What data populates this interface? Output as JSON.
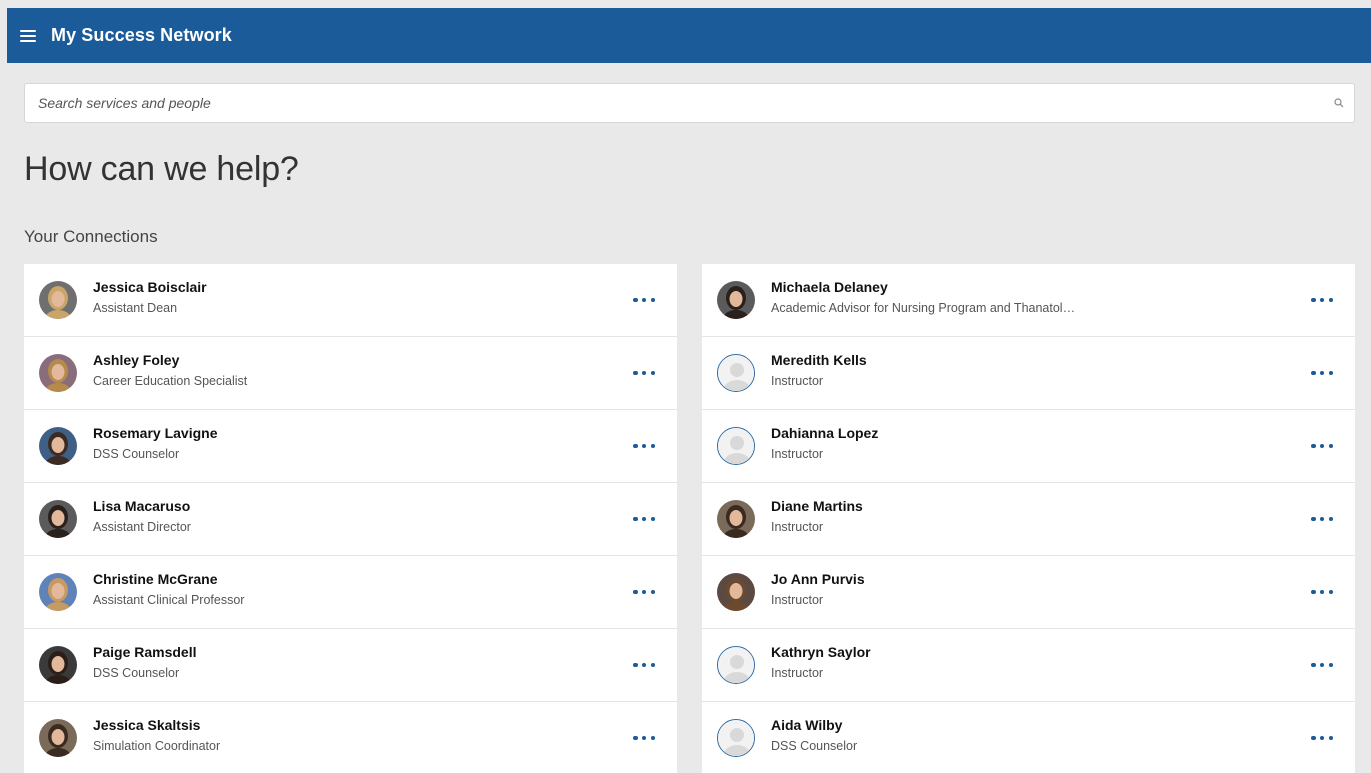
{
  "header": {
    "app_title": "My Success Network"
  },
  "search": {
    "placeholder": "Search services and people"
  },
  "page": {
    "heading": "How can we help?",
    "subheading": "Your Connections"
  },
  "connections_left": [
    {
      "name": "Jessica Boisclair",
      "title": "Assistant Dean",
      "avatar": "photo"
    },
    {
      "name": "Ashley Foley",
      "title": "Career Education Specialist",
      "avatar": "photo"
    },
    {
      "name": "Rosemary Lavigne",
      "title": "DSS Counselor",
      "avatar": "photo"
    },
    {
      "name": "Lisa Macaruso",
      "title": "Assistant Director",
      "avatar": "photo"
    },
    {
      "name": "Christine McGrane",
      "title": "Assistant Clinical Professor",
      "avatar": "photo"
    },
    {
      "name": "Paige Ramsdell",
      "title": "DSS Counselor",
      "avatar": "photo"
    },
    {
      "name": "Jessica Skaltsis",
      "title": "Simulation Coordinator",
      "avatar": "photo"
    }
  ],
  "connections_right": [
    {
      "name": "Michaela Delaney",
      "title": "Academic Advisor for Nursing Program and Thanatol…",
      "avatar": "photo"
    },
    {
      "name": "Meredith Kells",
      "title": "Instructor",
      "avatar": "placeholder"
    },
    {
      "name": "Dahianna Lopez",
      "title": "Instructor",
      "avatar": "placeholder"
    },
    {
      "name": "Diane Martins",
      "title": "Instructor",
      "avatar": "photo"
    },
    {
      "name": "Jo Ann Purvis",
      "title": "Instructor",
      "avatar": "photo"
    },
    {
      "name": "Kathryn Saylor",
      "title": "Instructor",
      "avatar": "placeholder"
    },
    {
      "name": "Aida Wilby",
      "title": "DSS Counselor",
      "avatar": "placeholder"
    }
  ],
  "colors": {
    "brand": "#1c5b99",
    "background": "#e9e9e9"
  },
  "icons": {
    "menu": "hamburger-menu-icon",
    "search": "search-icon",
    "more": "more-options-icon"
  }
}
